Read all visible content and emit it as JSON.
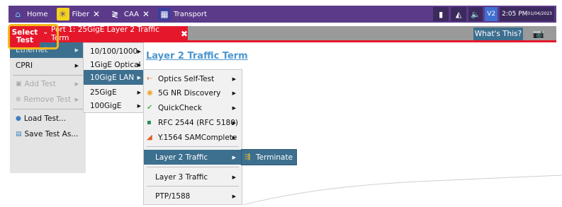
{
  "tabbar": {
    "home": "Home",
    "fiber": "Fiber",
    "caa": "CAA",
    "transport": "Transport",
    "close_glyph": "✕",
    "clock_time": "2:05 PM",
    "clock_date": "01/04/2023",
    "v_badge": "V2"
  },
  "subbar": {
    "port_tab": "Port 1: 25GigE Layer 2 Traffic Term",
    "port_close": "✖",
    "whats_this": "What's This?"
  },
  "select_test": {
    "line1": "Select",
    "line2": "Test",
    "chevron": "⌄"
  },
  "left_menu": {
    "items": [
      {
        "label": "Ethernet"
      },
      {
        "label": "CPRI"
      },
      {
        "label": "Add Test"
      },
      {
        "label": "Remove Test"
      },
      {
        "label": "Load Test..."
      },
      {
        "label": "Save Test As..."
      }
    ]
  },
  "content": {
    "title": "Layer 2 Traffic Term"
  },
  "menu_rates": {
    "items": [
      {
        "label": "10/100/1000"
      },
      {
        "label": "1GigE Optical"
      },
      {
        "label": "10GigE LAN"
      },
      {
        "label": "25GigE"
      },
      {
        "label": "100GigE"
      }
    ]
  },
  "menu_tests": {
    "items": [
      {
        "label": "Optics Self-Test",
        "icon": "optics-icon"
      },
      {
        "label": "5G NR Discovery",
        "icon": "5g-icon"
      },
      {
        "label": "QuickCheck",
        "icon": "checkmark-icon"
      },
      {
        "label": "RFC 2544 (RFC 5180)",
        "icon": "rfc-icon"
      },
      {
        "label": "Y.1564 SAMComplete",
        "icon": "signal-bars-icon"
      },
      {
        "label": "Layer 2 Traffic"
      },
      {
        "label": "Layer 3 Traffic"
      },
      {
        "label": "PTP/1588"
      }
    ]
  },
  "menu_action": {
    "items": [
      {
        "label": "Terminate",
        "icon": "terminate-icon"
      }
    ]
  },
  "colors": {
    "tabbar": "#5b3a8a",
    "accent_red": "#e5182b",
    "selection_blue": "#3d6f8f",
    "highlight_orange": "#f6b81b",
    "title_blue": "#4a96cf"
  }
}
